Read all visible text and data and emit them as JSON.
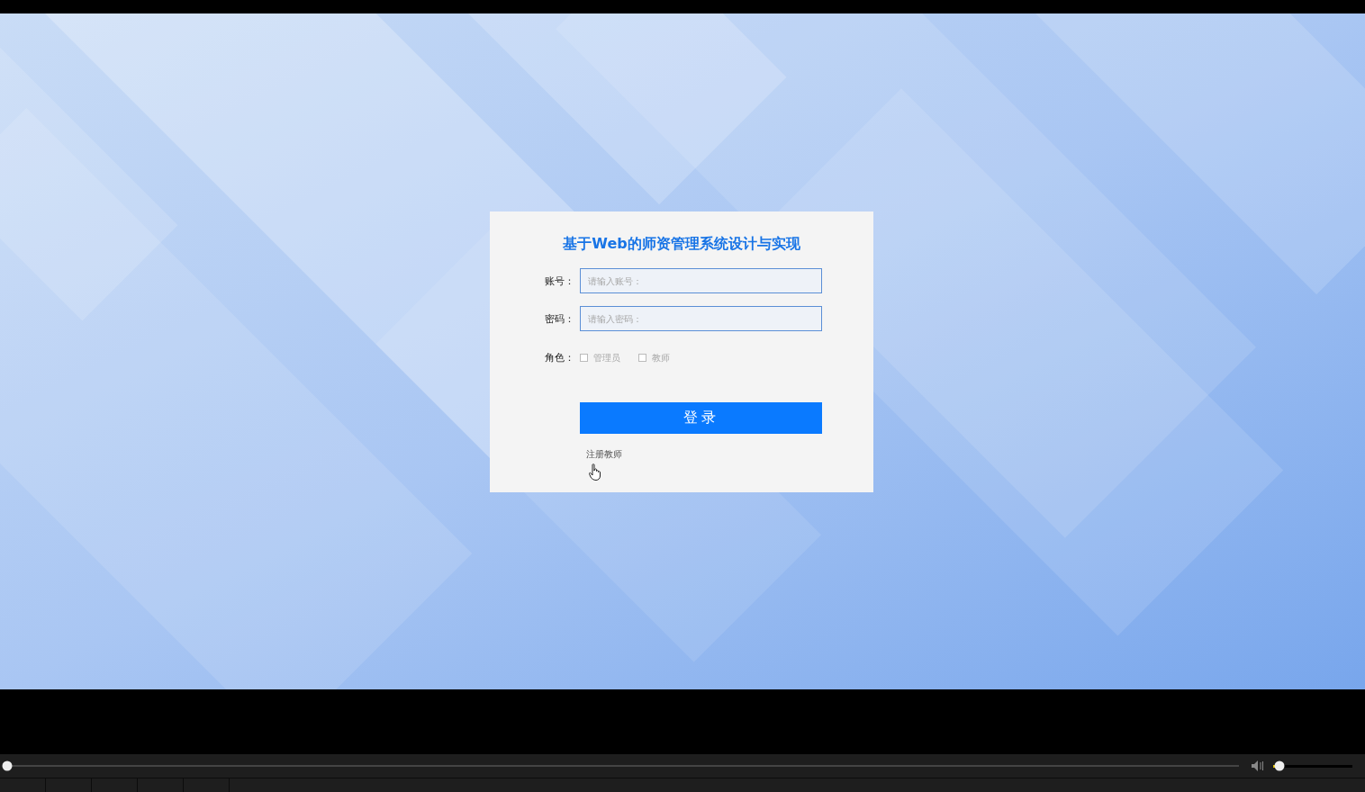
{
  "login": {
    "title": "基于Web的师资管理系统设计与实现",
    "fields": [
      {
        "label": "账号：",
        "placeholder": "请输入账号："
      },
      {
        "label": "密码：",
        "placeholder": "请输入密码："
      }
    ],
    "role": {
      "label": "角色：",
      "options": [
        {
          "label": "管理员",
          "checked": false
        },
        {
          "label": "教师",
          "checked": false
        }
      ]
    },
    "submit": "登录",
    "register_link": "注册教师"
  },
  "player": {
    "seek": {
      "level": 0
    },
    "volume": {
      "level": 0.08
    }
  }
}
